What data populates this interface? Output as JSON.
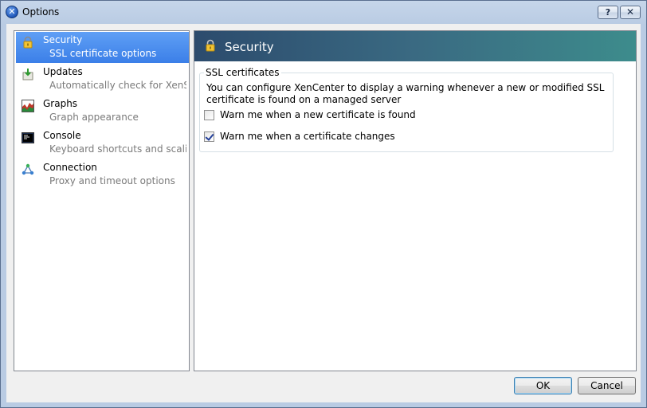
{
  "window": {
    "title": "Options",
    "help_label": "?",
    "close_label": "X"
  },
  "nav": {
    "items": [
      {
        "title": "Security",
        "subtitle": "SSL certificate options",
        "icon": "padlock-icon",
        "selected": true
      },
      {
        "title": "Updates",
        "subtitle": "Automatically check for XenS...",
        "icon": "update-download-icon",
        "selected": false
      },
      {
        "title": "Graphs",
        "subtitle": "Graph appearance",
        "icon": "graph-icon",
        "selected": false
      },
      {
        "title": "Console",
        "subtitle": "Keyboard shortcuts and scalin...",
        "icon": "console-icon",
        "selected": false
      },
      {
        "title": "Connection",
        "subtitle": "Proxy and timeout options",
        "icon": "network-icon",
        "selected": false
      }
    ]
  },
  "page": {
    "title": "Security",
    "group_label": "SSL certificates",
    "description": "You can configure XenCenter to display a warning whenever a new or modified SSL certificate is found on a managed server",
    "options": [
      {
        "label": "Warn me when a new certificate is found",
        "checked": false
      },
      {
        "label": "Warn me when a certificate changes",
        "checked": true
      }
    ]
  },
  "buttons": {
    "ok_label": "OK",
    "cancel_label": "Cancel"
  },
  "colors": {
    "selection": "#3b7fe8",
    "banner_start": "#2c4b6d",
    "banner_end": "#3d8c8c"
  }
}
